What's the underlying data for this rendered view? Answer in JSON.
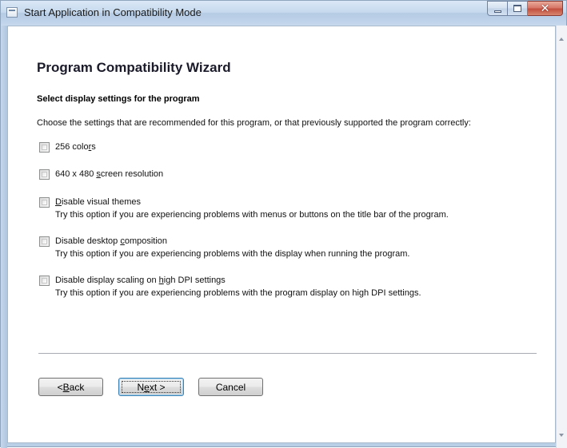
{
  "window": {
    "title": "Start Application in Compatibility Mode"
  },
  "wizard": {
    "title": "Program Compatibility Wizard",
    "section_heading": "Select display settings for the program",
    "instruction": "Choose the settings that are recommended for this program, or that previously supported the program correctly:"
  },
  "options": [
    {
      "label_pre": "256 colo",
      "label_key": "r",
      "label_post": "s",
      "description": "",
      "checked": false
    },
    {
      "label_pre": "640 x 480 ",
      "label_key": "s",
      "label_post": "creen resolution",
      "description": "",
      "checked": false
    },
    {
      "label_pre": "",
      "label_key": "D",
      "label_post": "isable visual themes",
      "description": "Try this option if you are experiencing problems with menus or buttons on the title bar of the program.",
      "checked": false
    },
    {
      "label_pre": "Disable desktop ",
      "label_key": "c",
      "label_post": "omposition",
      "description": "Try this option if you are experiencing problems with the display when running the program.",
      "checked": false
    },
    {
      "label_pre": "Disable display scaling on ",
      "label_key": "h",
      "label_post": "igh DPI settings",
      "description": "Try this option if you are experiencing problems with the program display on high DPI settings.",
      "checked": false
    }
  ],
  "buttons": {
    "back": {
      "pre": "< ",
      "key": "B",
      "post": "ack"
    },
    "next": {
      "pre": "N",
      "key": "e",
      "post": "xt >"
    },
    "cancel": {
      "pre": "",
      "key": "",
      "post": "Cancel"
    }
  },
  "icons": {
    "app": "app-window-icon",
    "minimize": "minimize-icon",
    "maximize": "maximize-icon",
    "close": "close-icon"
  },
  "colors": {
    "title_bar": "#c6d9ee",
    "close_button": "#c24f3f",
    "default_button_border": "#3c7fb1"
  }
}
